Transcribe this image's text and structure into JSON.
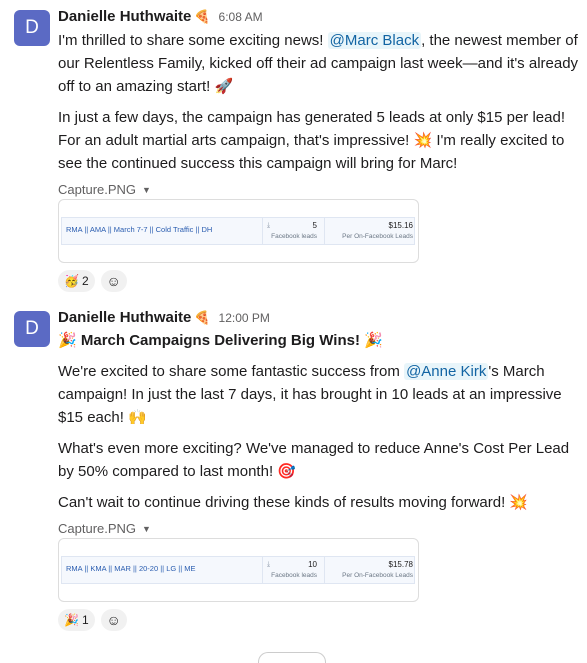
{
  "messages": [
    {
      "avatar_initial": "D",
      "author": "Danielle Huthwaite",
      "status_emoji": "🍕",
      "time": "6:08 AM",
      "p1": {
        "before": "I'm thrilled to share some exciting news! ",
        "mention": "@Marc Black",
        "after": ", the newest member of our Relentless Family, kicked off their ad campaign last week—and it's already off to an amazing start! ",
        "emoji": "🚀"
      },
      "p2": {
        "before": "In just a few days, the campaign has generated 5 leads at only $15 per lead! For an adult martial arts campaign, that's impressive! ",
        "emoji": "💥",
        "after": " I'm really excited to see the continued success this campaign will bring for Marc!"
      },
      "attachment": {
        "filename": "Capture.PNG",
        "campaign": "RMA || AMA || March 7-7 || Cold Traffic || DH",
        "leads_value": "5",
        "leads_label": "Facebook leads",
        "cost_value": "$15.16",
        "cost_label": "Per On-Facebook Leads"
      },
      "reaction": {
        "emoji": "🥳",
        "count": "2"
      },
      "add_reaction_icon": "☺"
    },
    {
      "avatar_initial": "D",
      "author": "Danielle Huthwaite",
      "status_emoji": "🍕",
      "time": "12:00 PM",
      "headline": {
        "emoji_left": "🎉",
        "text": "March Campaigns Delivering Big Wins!",
        "emoji_right": "🎉"
      },
      "p1": {
        "before": "We're excited to share some fantastic success from ",
        "mention": "@Anne Kirk",
        "after": "'s March campaign! In just the last 7 days, it has brought in 10 leads at an impressive $15 each! ",
        "emoji": "🙌"
      },
      "p2": {
        "before": "What's even more exciting? We've managed to reduce Anne's Cost Per Lead by 50% compared to last month! ",
        "emoji": "🎯"
      },
      "p3": {
        "before": "Can't wait to continue driving these kinds of results moving forward! ",
        "emoji": "💥"
      },
      "attachment": {
        "filename": "Capture.PNG",
        "campaign": "RMA || KMA || MAR || 20-20 || LG || ME",
        "leads_value": "10",
        "leads_label": "Facebook leads",
        "cost_value": "$15.78",
        "cost_label": "Per On-Facebook Leads"
      },
      "reaction": {
        "emoji": "🎉",
        "count": "1"
      },
      "add_reaction_icon": "☺"
    }
  ],
  "icons": {
    "dropdown": "▼",
    "download": "⤓"
  }
}
